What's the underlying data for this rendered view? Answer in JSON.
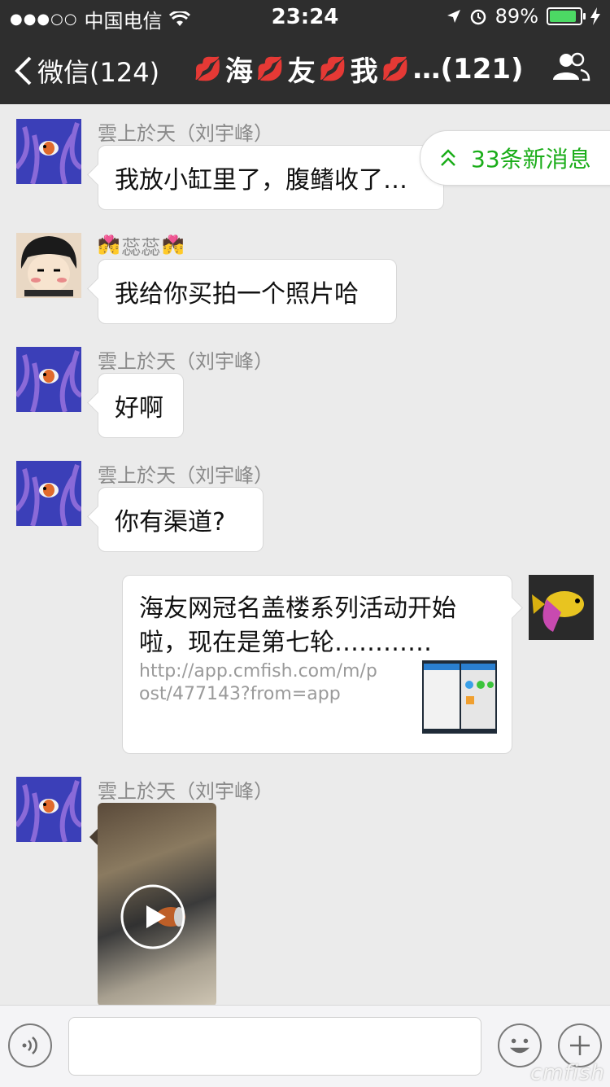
{
  "status_bar": {
    "signal": "●●●○○",
    "carrier": "中国电信",
    "time": "23:24",
    "battery_percent": "89%",
    "battery_level": 0.89
  },
  "nav": {
    "back_label": "微信(124)",
    "title_chars": [
      "海",
      "友",
      "我"
    ],
    "title_suffix": "…(121)"
  },
  "new_messages_label": "33条新消息",
  "messages": [
    {
      "sender": "雲上於天（刘宇峰）",
      "text": "我放小缸里了，腹鳍收了…"
    },
    {
      "sender": "蕊蕊",
      "text": "我给你买拍一个照片哈"
    },
    {
      "sender": "雲上於天（刘宇峰）",
      "text": "好啊"
    },
    {
      "sender": "雲上於天（刘宇峰）",
      "text": "你有渠道?"
    },
    {
      "sender": "雲上於天（刘宇峰）",
      "text": ""
    }
  ],
  "link_card": {
    "title": "海友网冠名盖楼系列活动开始啦，现在是第七轮…………",
    "url": "http://app.cmfish.com/m/post/477143?from=app"
  },
  "watermark": "cmfish",
  "colors": {
    "accent_green": "#1aad19",
    "nav_bg": "#2e2e2e",
    "chat_bg": "#ebebeb",
    "kiss_red": "#e8324b"
  }
}
